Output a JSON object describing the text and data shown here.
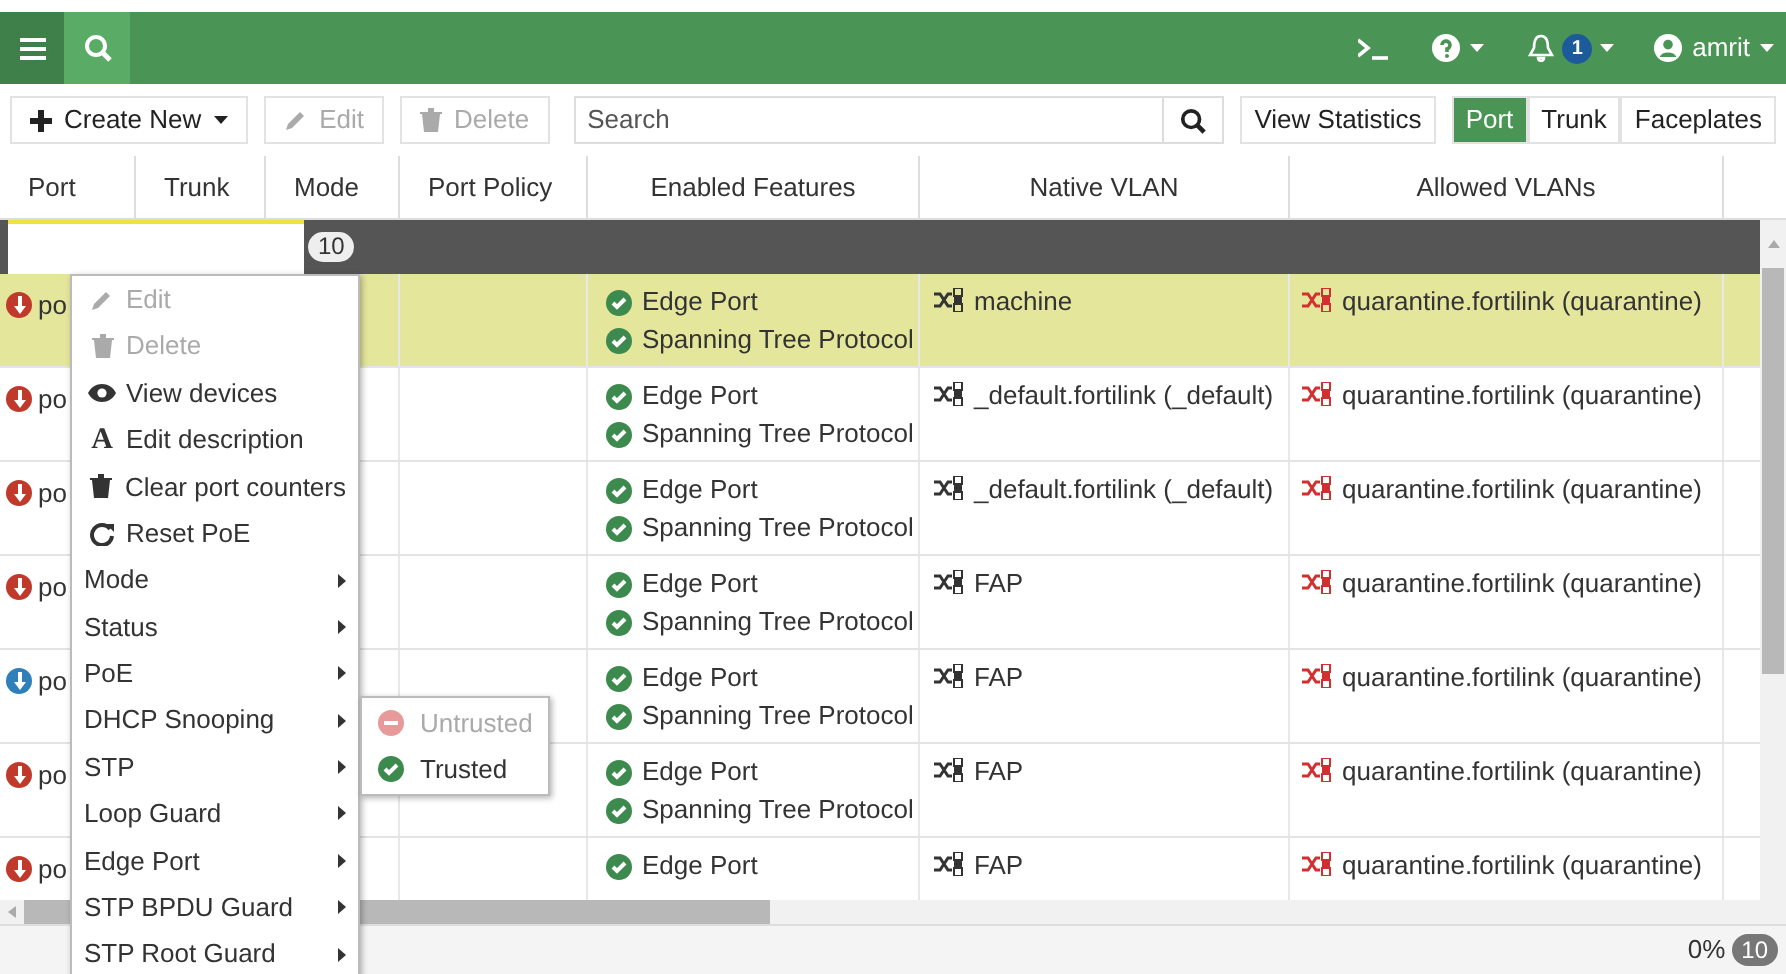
{
  "top_bar": {
    "notification_count": "1",
    "user": "amrit"
  },
  "toolbar": {
    "buttons": [
      {
        "label": "Create New",
        "kind": "create",
        "disabled": false
      },
      {
        "label": "Edit",
        "kind": "edit",
        "disabled": true
      },
      {
        "label": "Delete",
        "kind": "delete",
        "disabled": true
      }
    ],
    "search": {
      "placeholder": "Search"
    },
    "view_statistics": "View Statistics",
    "views": [
      {
        "label": "Port",
        "selected": true
      },
      {
        "label": "Trunk",
        "selected": false
      },
      {
        "label": "Faceplates",
        "selected": false
      }
    ]
  },
  "table": {
    "columns": [
      "Port",
      "Trunk",
      "Mode",
      "Port Policy",
      "Enabled Features",
      "Native VLAN",
      "Allowed VLANs"
    ],
    "group": {
      "count": "10"
    },
    "rows": [
      {
        "selected": true,
        "port": {
          "color": "#c0392b",
          "text": "po"
        },
        "features": [
          "Edge Port",
          "Spanning Tree Protocol"
        ],
        "native_vlan": "machine",
        "allowed_vlans": "quarantine.fortilink (quarantine)"
      },
      {
        "selected": false,
        "port": {
          "color": "#c0392b",
          "text": "po"
        },
        "features": [
          "Edge Port",
          "Spanning Tree Protocol"
        ],
        "native_vlan": "_default.fortilink (_default)",
        "allowed_vlans": "quarantine.fortilink (quarantine)"
      },
      {
        "selected": false,
        "port": {
          "color": "#c0392b",
          "text": "po"
        },
        "features": [
          "Edge Port",
          "Spanning Tree Protocol"
        ],
        "native_vlan": "_default.fortilink (_default)",
        "allowed_vlans": "quarantine.fortilink (quarantine)"
      },
      {
        "selected": false,
        "port": {
          "color": "#c0392b",
          "text": "po"
        },
        "features": [
          "Edge Port",
          "Spanning Tree Protocol"
        ],
        "native_vlan": "FAP",
        "allowed_vlans": "quarantine.fortilink (quarantine)"
      },
      {
        "selected": false,
        "port": {
          "color": "#2f7fb8",
          "text": "po"
        },
        "features": [
          "Edge Port",
          "Spanning Tree Protocol"
        ],
        "native_vlan": "FAP",
        "allowed_vlans": "quarantine.fortilink (quarantine)"
      },
      {
        "selected": false,
        "port": {
          "color": "#c0392b",
          "text": "po"
        },
        "features": [
          "Edge Port",
          "Spanning Tree Protocol"
        ],
        "native_vlan": "FAP",
        "allowed_vlans": "quarantine.fortilink (quarantine)"
      },
      {
        "selected": false,
        "port": {
          "color": "#c0392b",
          "text": "po"
        },
        "features": [
          "Edge Port"
        ],
        "native_vlan": "FAP",
        "allowed_vlans": "quarantine.fortilink (quarantine)"
      }
    ]
  },
  "context_menu": {
    "items": [
      {
        "label": "Edit",
        "kind": "edit",
        "disabled": true
      },
      {
        "label": "Delete",
        "kind": "delete",
        "disabled": true
      },
      {
        "label": "View devices",
        "kind": "view",
        "disabled": false
      },
      {
        "label": "Edit description",
        "kind": "describe",
        "icon_text": "A",
        "disabled": false
      },
      {
        "label": "Clear port counters",
        "kind": "clear",
        "disabled": false
      },
      {
        "label": "Reset PoE",
        "kind": "reset",
        "disabled": false
      },
      {
        "label": "Mode",
        "kind": "submenu",
        "disabled": false
      },
      {
        "label": "Status",
        "kind": "submenu",
        "disabled": false
      },
      {
        "label": "PoE",
        "kind": "submenu",
        "disabled": false
      },
      {
        "label": "DHCP Snooping",
        "kind": "submenu",
        "disabled": false
      },
      {
        "label": "STP",
        "kind": "submenu",
        "disabled": false
      },
      {
        "label": "Loop Guard",
        "kind": "submenu",
        "disabled": false
      },
      {
        "label": "Edge Port",
        "kind": "submenu",
        "disabled": false
      },
      {
        "label": "STP BPDU Guard",
        "kind": "submenu",
        "disabled": false
      },
      {
        "label": "STP Root Guard",
        "kind": "submenu",
        "disabled": false
      }
    ]
  },
  "submenu": {
    "items": [
      {
        "label": "Untrusted",
        "kind": "untrusted",
        "disabled": true
      },
      {
        "label": "Trusted",
        "kind": "trusted",
        "disabled": false
      }
    ]
  },
  "footer": {
    "percent": "0%",
    "count": "10"
  }
}
